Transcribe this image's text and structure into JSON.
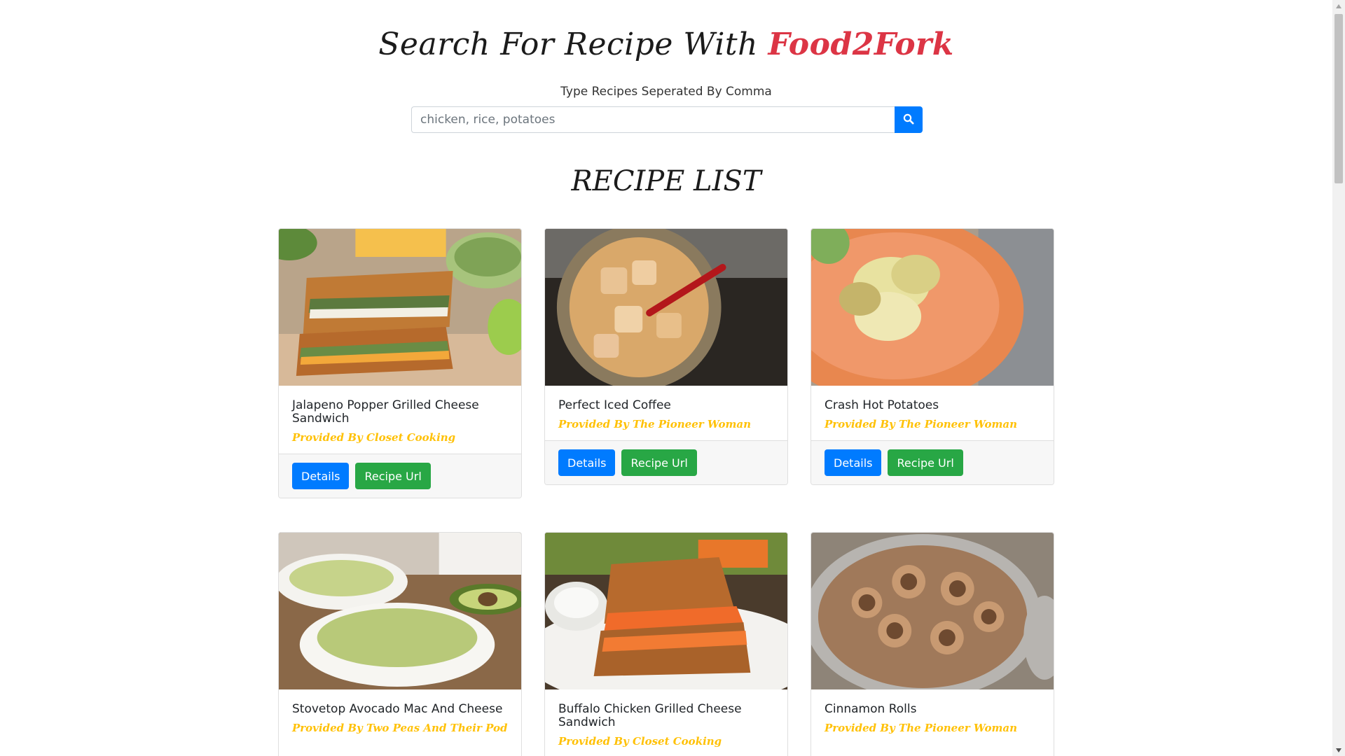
{
  "header": {
    "title_prefix": "Search For Recipe With",
    "title_brand": "Food2Fork",
    "subtitle": "Type Recipes Seperated By Comma"
  },
  "search": {
    "value": "",
    "placeholder": "chicken, rice, potatoes",
    "button_icon": "search-icon"
  },
  "recipe_section": {
    "title": "RECIPE LIST"
  },
  "recipes": [
    {
      "title": "Jalapeno Popper Grilled Cheese Sandwich",
      "provider": "Provided By Closet Cooking",
      "details_label": "Details",
      "url_label": "Recipe Url"
    },
    {
      "title": "Perfect Iced Coffee",
      "provider": "Provided By The Pioneer Woman",
      "details_label": "Details",
      "url_label": "Recipe Url"
    },
    {
      "title": "Crash Hot Potatoes",
      "provider": "Provided By The Pioneer Woman",
      "details_label": "Details",
      "url_label": "Recipe Url"
    },
    {
      "title": "Stovetop Avocado Mac And Cheese",
      "provider": "Provided By Two Peas And Their Pod"
    },
    {
      "title": "Buffalo Chicken Grilled Cheese Sandwich",
      "provider": "Provided By Closet Cooking"
    },
    {
      "title": "Cinnamon Rolls",
      "provider": "Provided By The Pioneer Woman"
    }
  ],
  "colors": {
    "brand": "#dc3545",
    "provider": "#ffc107",
    "primary": "#007bff",
    "success": "#28a745"
  }
}
